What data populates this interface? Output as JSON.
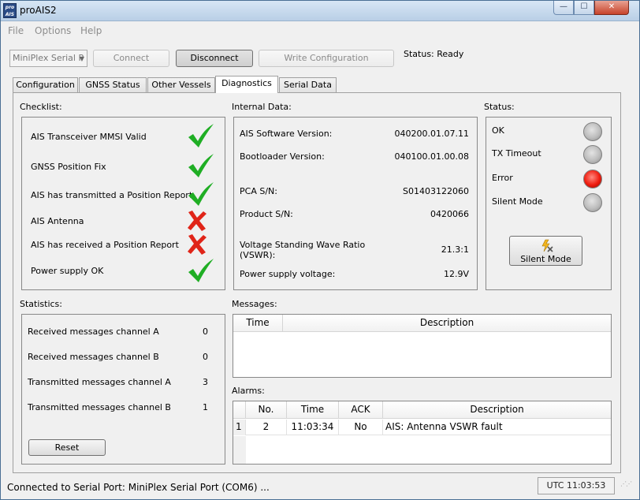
{
  "window": {
    "title": "proAIS2",
    "icon_text_top": "pro",
    "icon_text_bottom": "AIS",
    "minimize_glyph": "—",
    "maximize_glyph": "☐",
    "close_glyph": "✕"
  },
  "menu": [
    "File",
    "Options",
    "Help"
  ],
  "toolbar": {
    "port_select_value": "MiniPlex Serial P",
    "connect_label": "Connect",
    "disconnect_label": "Disconnect",
    "write_config_label": "Write Configuration",
    "status_text": "Status: Ready"
  },
  "tabs": [
    "Configuration",
    "GNSS Status",
    "Other Vessels",
    "Diagnostics",
    "Serial Data"
  ],
  "active_tab": "Diagnostics",
  "checklist": {
    "label": "Checklist:",
    "items": [
      {
        "text": "AIS Transceiver MMSI Valid",
        "ok": true
      },
      {
        "text": "GNSS Position Fix",
        "ok": true
      },
      {
        "text": "AIS has transmitted a Position Report",
        "ok": true
      },
      {
        "text": "AIS Antenna",
        "ok": false
      },
      {
        "text": "AIS has received a Position Report",
        "ok": false
      },
      {
        "text": "Power supply OK",
        "ok": true
      }
    ]
  },
  "internal_data": {
    "label": "Internal Data:",
    "items": [
      {
        "label": "AIS Software Version:",
        "value": "040200.01.07.11"
      },
      {
        "label": "Bootloader Version:",
        "value": "040100.01.00.08"
      },
      {
        "label": "PCA S/N:",
        "value": "S01403122060"
      },
      {
        "label": "Product S/N:",
        "value": "0420066"
      },
      {
        "label": "Voltage Standing Wave Ratio",
        "label2": "(VSWR):",
        "value": "21.3:1"
      },
      {
        "label": "Power supply voltage:",
        "value": "12.9V"
      }
    ]
  },
  "status_panel": {
    "label": "Status:",
    "items": [
      {
        "text": "OK",
        "state": "off"
      },
      {
        "text": "TX Timeout",
        "state": "off"
      },
      {
        "text": "Error",
        "state": "on"
      },
      {
        "text": "Silent Mode",
        "state": "off"
      }
    ],
    "silent_button_label": "Silent Mode"
  },
  "statistics": {
    "label": "Statistics:",
    "items": [
      {
        "text": "Received messages channel A",
        "value": "0"
      },
      {
        "text": "Received messages channel B",
        "value": "0"
      },
      {
        "text": "Transmitted messages channel A",
        "value": "3"
      },
      {
        "text": "Transmitted messages channel B",
        "value": "1"
      }
    ],
    "reset_label": "Reset"
  },
  "messages": {
    "label": "Messages:",
    "columns": [
      "Time",
      "Description"
    ],
    "rows": []
  },
  "alarms": {
    "label": "Alarms:",
    "columns": [
      "No.",
      "Time",
      "ACK",
      "Description"
    ],
    "rows": [
      {
        "index": "1",
        "no": "2",
        "time": "11:03:34",
        "ack": "No",
        "description": "AIS: Antenna VSWR fault"
      }
    ]
  },
  "statusbar": {
    "text": "Connected to Serial Port: MiniPlex Serial Port (COM6) ...",
    "clock": "UTC  11:03:53"
  },
  "colors": {
    "check": "#1fae24",
    "cross": "#e02418",
    "led_error": "#ef1c0f",
    "led_off": "#bdbdbd"
  }
}
